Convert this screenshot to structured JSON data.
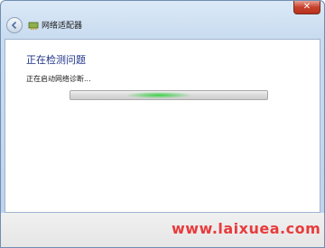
{
  "window": {
    "title": "网络适配器",
    "close_label": "✕"
  },
  "content": {
    "heading": "正在检测问题",
    "status": "正在启动网络诊断..."
  },
  "progress": {
    "mode": "indeterminate",
    "glow_position": 0.45
  },
  "watermark": {
    "text": "www.laixuea.com"
  },
  "icons": {
    "back": "back-arrow-icon",
    "app": "network-adapter-icon",
    "close": "close-icon"
  },
  "colors": {
    "heading": "#1e3287",
    "progress_glow": "#3fd14a",
    "close_button": "#c7412c",
    "watermark": "#e83b3b"
  }
}
